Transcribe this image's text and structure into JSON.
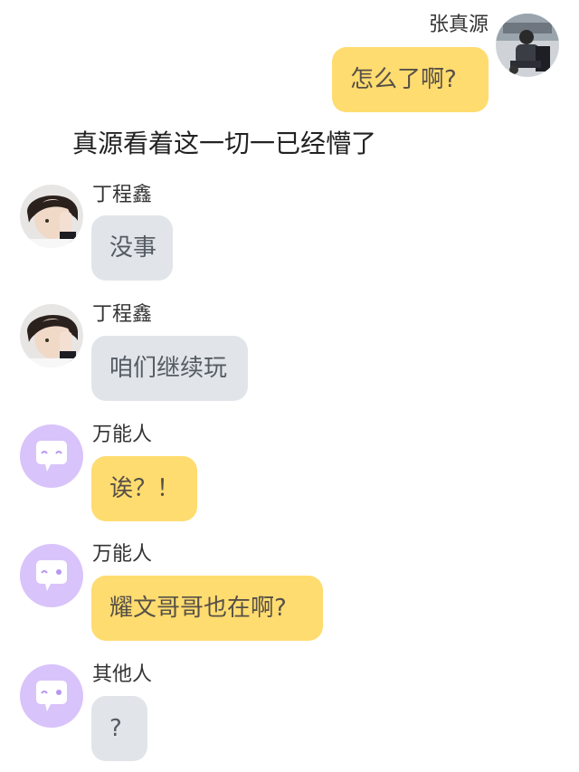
{
  "messages": [
    {
      "side": "right",
      "sender": "张真源",
      "text": "怎么了啊?",
      "bubble_color": "#ffdc6f",
      "avatar": "photo-avatar-zhang-zhenyuan"
    },
    {
      "side": "narration",
      "text": "真源看着这一切一已经懵了"
    },
    {
      "side": "left",
      "sender": "丁程鑫",
      "text": "没事",
      "bubble_color": "#e1e5ea",
      "avatar": "photo-avatar-ding-chengxin"
    },
    {
      "side": "left",
      "sender": "丁程鑫",
      "text": "咱们继续玩",
      "bubble_color": "#e1e5ea",
      "avatar": "photo-avatar-ding-chengxin"
    },
    {
      "side": "left",
      "sender": "万能人",
      "text": "诶？！",
      "bubble_color": "#ffdc6f",
      "avatar": "chat-bubble-icon"
    },
    {
      "side": "left",
      "sender": "万能人",
      "text": "耀文哥哥也在啊?",
      "bubble_color": "#ffdc6f",
      "avatar": "chat-bubble-icon"
    },
    {
      "side": "left",
      "sender": "其他人",
      "text": "?",
      "bubble_color": "#e1e5ea",
      "avatar": "chat-bubble-icon"
    }
  ],
  "colors": {
    "yellow_bubble": "#ffdc6f",
    "gray_bubble": "#e1e5ea",
    "icon_avatar_bg": "#d9c3fb"
  }
}
